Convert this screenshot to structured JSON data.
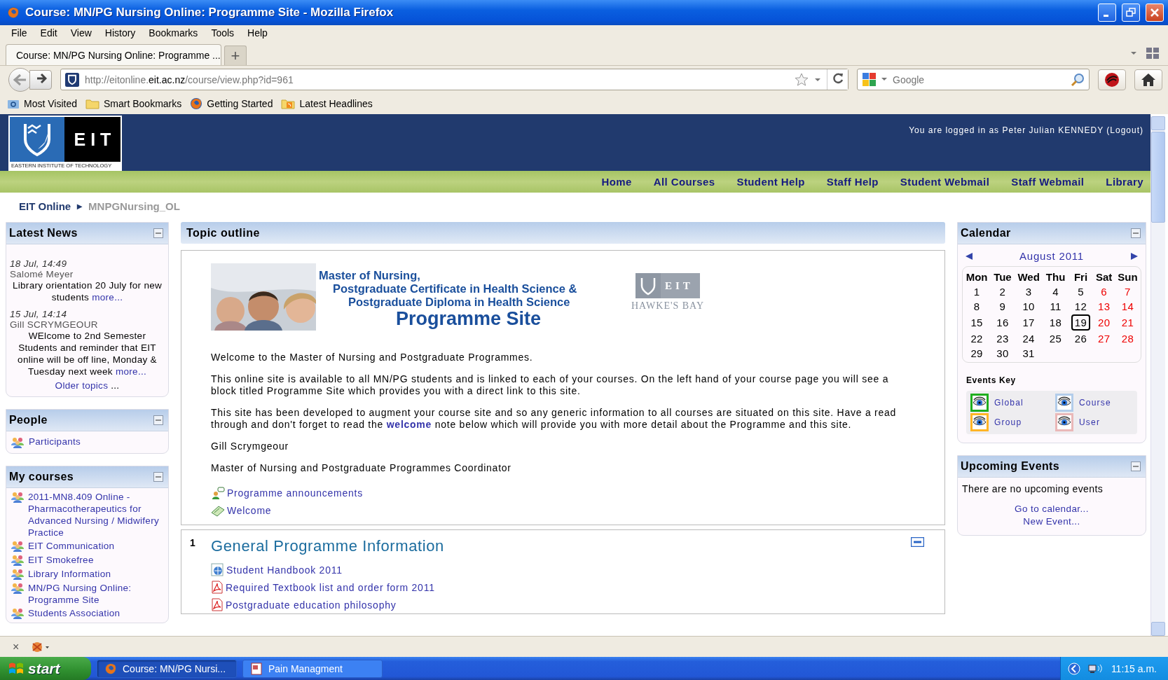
{
  "window": {
    "title": "Course: MN/PG Nursing Online: Programme Site - Mozilla Firefox"
  },
  "menu": [
    "File",
    "Edit",
    "View",
    "History",
    "Bookmarks",
    "Tools",
    "Help"
  ],
  "tabs": [
    {
      "label": "Course: MN/PG Nursing Online: Programme ...",
      "selected": true
    }
  ],
  "new_tab": "+",
  "address": {
    "prefix": "http://eitonline.",
    "domain": "eit.ac.nz",
    "path": "/course/view.php?id=961"
  },
  "search": {
    "placeholder": "Google"
  },
  "bookmarks": [
    {
      "label": "Most Visited",
      "kind": "smart"
    },
    {
      "label": "Smart Bookmarks",
      "kind": "folder"
    },
    {
      "label": "Getting Started",
      "kind": "firefox"
    },
    {
      "label": "Latest Headlines",
      "kind": "feed"
    }
  ],
  "site": {
    "logo": "E I T",
    "logo_subtitle": "EASTERN INSTITUTE OF TECHNOLOGY",
    "login_text": "You are logged in as Peter Julian KENNEDY",
    "logout": "(Logout)",
    "nav": [
      "Home",
      "All Courses",
      "Student Help",
      "Staff Help",
      "Student Webmail",
      "Staff Webmail",
      "Library"
    ]
  },
  "breadcrumb": {
    "separator": "►",
    "items": [
      {
        "label": "EIT Online",
        "kind": "link"
      },
      {
        "label": "MNPGNursing_OL",
        "kind": "current"
      }
    ]
  },
  "latest_news": {
    "title": "Latest News",
    "items": [
      {
        "date": "18 Jul, 14:49",
        "author": "Salomé Meyer",
        "text": "Library orientation 20 July for new students",
        "more": "more..."
      },
      {
        "date": "15 Jul, 14:14",
        "author": "Gill SCRYMGEOUR",
        "text": "WElcome to 2nd Semester Students and reminder that EIT online will be off line, Monday & Tuesday next week",
        "more": "more..."
      }
    ],
    "older": "Older topics",
    "older_suffix": "..."
  },
  "people": {
    "title": "People",
    "items": [
      "Participants"
    ]
  },
  "my_courses": {
    "title": "My courses",
    "items": [
      "2011-MN8.409 Online - Pharmacotherapeutics for Advanced Nursing / Midwifery Practice",
      "EIT Communication",
      "EIT Smokefree",
      "Library Information",
      "MN/PG Nursing Online: Programme Site",
      "Students Association"
    ]
  },
  "topic_outline": {
    "title": "Topic outline",
    "banner": {
      "lines": [
        "Master of Nursing,",
        "Postgraduate Certificate in Health Science &",
        "Postgraduate Diploma in Health Science"
      ],
      "headline": "Programme Site"
    },
    "partner_logo": {
      "name": "EIT",
      "place": "HAWKE'S BAY"
    },
    "paragraphs": [
      "Welcome to the Master of Nursing and Postgraduate Programmes.",
      "This online site is available to all MN/PG students and is linked to each of your courses.  On the left hand of your course page you will see a block titled Programme Site which provides you with a direct link to this site.",
      "This site has been developed to augment your course site and so any generic information to all courses are situated on this site. Have a read through and don't forget to read the **welcome** note below which will provide you with more detail about the Programme and this site.",
      "Gill Scrymgeour",
      "Master of Nursing and Postgraduate Programmes Coordinator"
    ],
    "resources": [
      {
        "label": "Programme announcements",
        "kind": "forum"
      },
      {
        "label": "Welcome",
        "kind": "page"
      }
    ]
  },
  "section": {
    "number": "1",
    "title": "General Programme Information",
    "resources": [
      {
        "label": "Student Handbook 2011",
        "kind": "web"
      },
      {
        "label": "Required Textbook list and order form 2011",
        "kind": "pdf"
      },
      {
        "label": "Postgraduate education philosophy",
        "kind": "pdf"
      }
    ]
  },
  "calendar": {
    "title": "Calendar",
    "month": "August 2011",
    "weekdays": [
      "Mon",
      "Tue",
      "Wed",
      "Thu",
      "Fri",
      "Sat",
      "Sun"
    ],
    "weeks": [
      [
        {
          "day": "1",
          "weekend": false,
          "today": false
        },
        {
          "day": "2",
          "weekend": false,
          "today": false
        },
        {
          "day": "3",
          "weekend": false,
          "today": false
        },
        {
          "day": "4",
          "weekend": false,
          "today": false
        },
        {
          "day": "5",
          "weekend": false,
          "today": false
        },
        {
          "day": "6",
          "weekend": true,
          "today": false
        },
        {
          "day": "7",
          "weekend": true,
          "today": false
        }
      ],
      [
        {
          "day": "8",
          "weekend": false,
          "today": false
        },
        {
          "day": "9",
          "weekend": false,
          "today": false
        },
        {
          "day": "10",
          "weekend": false,
          "today": false
        },
        {
          "day": "11",
          "weekend": false,
          "today": false
        },
        {
          "day": "12",
          "weekend": false,
          "today": false
        },
        {
          "day": "13",
          "weekend": true,
          "today": false
        },
        {
          "day": "14",
          "weekend": true,
          "today": false
        }
      ],
      [
        {
          "day": "15",
          "weekend": false,
          "today": false
        },
        {
          "day": "16",
          "weekend": false,
          "today": false
        },
        {
          "day": "17",
          "weekend": false,
          "today": false
        },
        {
          "day": "18",
          "weekend": false,
          "today": false
        },
        {
          "day": "19",
          "weekend": false,
          "today": true
        },
        {
          "day": "20",
          "weekend": true,
          "today": false
        },
        {
          "day": "21",
          "weekend": true,
          "today": false
        }
      ],
      [
        {
          "day": "22",
          "weekend": false,
          "today": false
        },
        {
          "day": "23",
          "weekend": false,
          "today": false
        },
        {
          "day": "24",
          "weekend": false,
          "today": false
        },
        {
          "day": "25",
          "weekend": false,
          "today": false
        },
        {
          "day": "26",
          "weekend": false,
          "today": false
        },
        {
          "day": "27",
          "weekend": true,
          "today": false
        },
        {
          "day": "28",
          "weekend": true,
          "today": false
        }
      ],
      [
        {
          "day": "29",
          "weekend": false,
          "today": false
        },
        {
          "day": "30",
          "weekend": false,
          "today": false
        },
        {
          "day": "31",
          "weekend": false,
          "today": false
        }
      ]
    ],
    "events_key": {
      "title": "Events Key",
      "items": [
        {
          "label": "Global",
          "color": "#1fae1f"
        },
        {
          "label": "Course",
          "color": "#b3cdea"
        },
        {
          "label": "Group",
          "color": "#ffb526"
        },
        {
          "label": "User",
          "color": "#eab8b8"
        }
      ]
    }
  },
  "upcoming": {
    "title": "Upcoming Events",
    "text": "There are no upcoming events",
    "links": [
      "Go to calendar...",
      "New Event..."
    ]
  },
  "addon_bar": {
    "close": "×"
  },
  "taskbar": {
    "start": "start",
    "tasks": [
      {
        "label": "Course: MN/PG Nursi...",
        "kind": "firefox",
        "selected": true
      },
      {
        "label": "Pain Managment",
        "kind": "document",
        "selected": false
      }
    ],
    "clock": "11:15 a.m."
  }
}
